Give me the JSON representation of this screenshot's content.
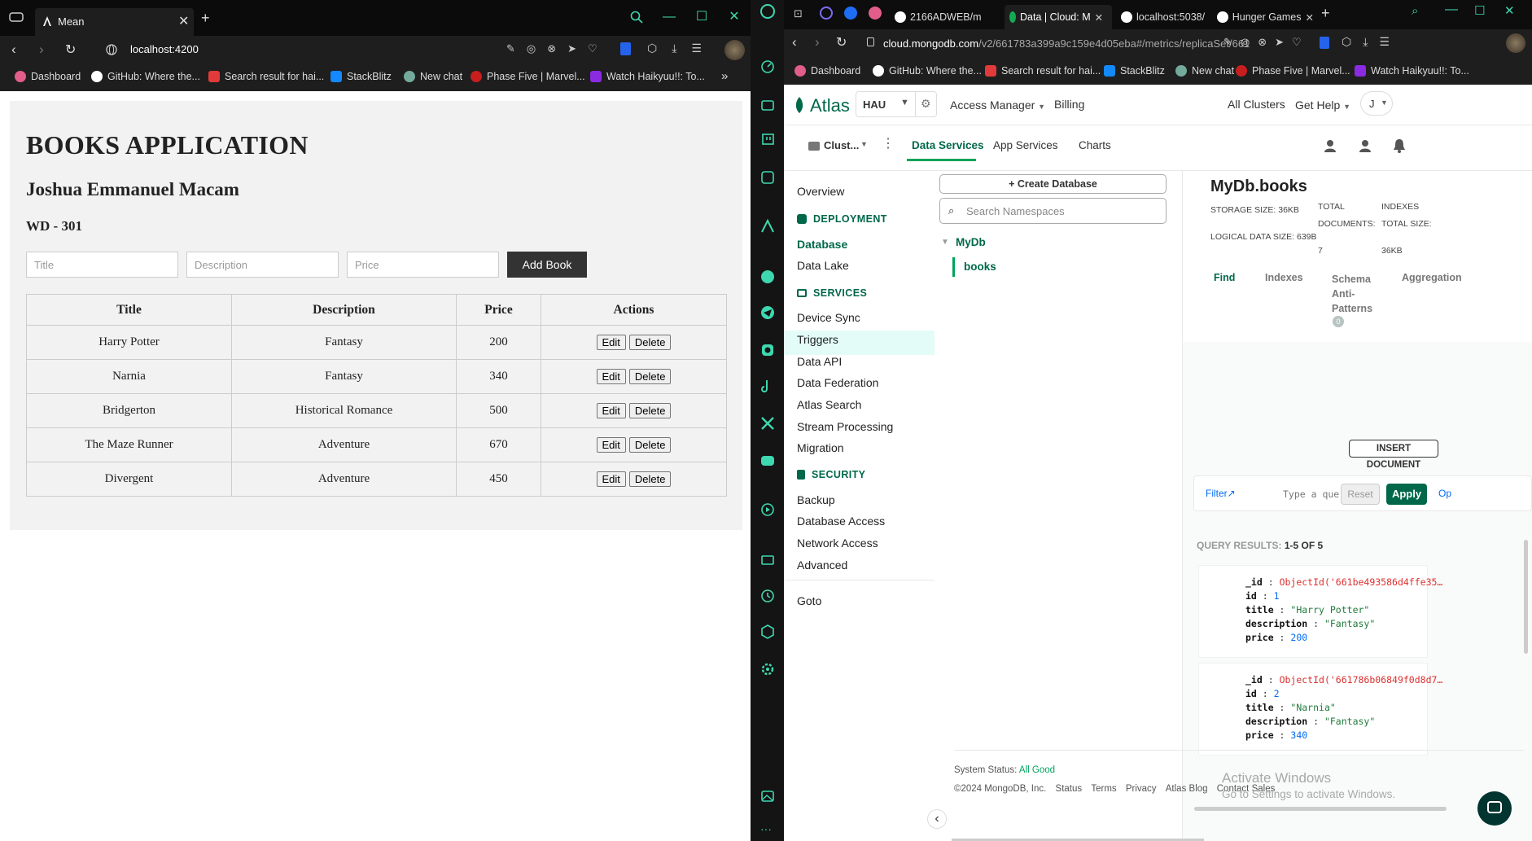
{
  "left_browser": {
    "tab_title": "Mean",
    "url": "localhost:4200",
    "bookmarks": [
      "Dashboard",
      "GitHub: Where the...",
      "Search result for hai...",
      "StackBlitz",
      "New chat",
      "Phase Five | Marvel...",
      "Watch Haikyuu!!: To..."
    ]
  },
  "books_app": {
    "title": "BOOKS APPLICATION",
    "author": "Joshua Emmanuel Macam",
    "section": "WD - 301",
    "inputs": {
      "title_placeholder": "Title",
      "description_placeholder": "Description",
      "price_placeholder": "Price"
    },
    "add_button": "Add Book",
    "columns": [
      "Title",
      "Description",
      "Price",
      "Actions"
    ],
    "rows": [
      {
        "title": "Harry Potter",
        "description": "Fantasy",
        "price": "200"
      },
      {
        "title": "Narnia",
        "description": "Fantasy",
        "price": "340"
      },
      {
        "title": "Bridgerton",
        "description": "Historical Romance",
        "price": "500"
      },
      {
        "title": "The Maze Runner",
        "description": "Adventure",
        "price": "670"
      },
      {
        "title": "Divergent",
        "description": "Adventure",
        "price": "450"
      }
    ],
    "edit_label": "Edit",
    "delete_label": "Delete"
  },
  "right_browser": {
    "tabs": [
      "2166ADWEB/m",
      "Data | Cloud: M",
      "localhost:5038/",
      "Hunger Games"
    ],
    "url_domain": "cloud.mongodb.com",
    "url_path": "/v2/661783a399a9c159e4d05eba#/metrics/replicaSet/661",
    "bookmarks": [
      "Dashboard",
      "GitHub: Where the...",
      "Search result for hai...",
      "StackBlitz",
      "New chat",
      "Phase Five | Marvel...",
      "Watch Haikyuu!!: To..."
    ]
  },
  "atlas": {
    "logo": "Atlas",
    "org": "HAU",
    "access_manager": "Access Manager",
    "billing": "Billing",
    "all_clusters": "All Clusters",
    "get_help": "Get Help",
    "user_initial": "J",
    "cluster_label": "Clust...",
    "top_tabs": [
      "Data Services",
      "App Services",
      "Charts"
    ],
    "nav": {
      "overview": "Overview",
      "deployment": "DEPLOYMENT",
      "deployment_items": [
        "Database",
        "Data Lake"
      ],
      "services": "SERVICES",
      "services_items": [
        "Device Sync",
        "Triggers",
        "Data API",
        "Data Federation",
        "Atlas Search",
        "Stream Processing",
        "Migration"
      ],
      "security": "SECURITY",
      "security_items": [
        "Backup",
        "Database Access",
        "Network Access",
        "Advanced"
      ],
      "goto": "Goto"
    },
    "create_db": "Create Database",
    "search_placeholder": "Search Namespaces",
    "db_name": "MyDb",
    "collection_name": "books",
    "collection_title": "MyDb.books",
    "storage_size": "STORAGE SIZE: 36KB",
    "logical_size": "LOGICAL DATA SIZE: 639B",
    "total_documents_label1": "TOTAL",
    "total_documents_label2": "DOCUMENTS:",
    "total_documents": "7",
    "indexes_label1": "INDEXES",
    "indexes_label2": "TOTAL SIZE:",
    "indexes_size": "36KB",
    "coll_tabs": [
      "Find",
      "Indexes",
      "Schema Anti-Patterns",
      "Aggregation"
    ],
    "schema_badge": "0",
    "insert_doc": "INSERT DOCUMENT",
    "filter": "Filter",
    "query_placeholder": "Type a que",
    "reset": "Reset",
    "apply": "Apply",
    "options_cut": "Op",
    "query_results_label": "QUERY RESULTS:",
    "query_results_range": "1-5 OF 5",
    "documents": [
      {
        "_id": "ObjectId('661be493586d4ffe35…",
        "id": "1",
        "title": "\"Harry Potter\"",
        "description": "\"Fantasy\"",
        "price": "200"
      },
      {
        "_id": "ObjectId('661786b06849f0d8d7…",
        "id": "2",
        "title": "\"Narnia\"",
        "description": "\"Fantasy\"",
        "price": "340"
      }
    ],
    "system_status_label": "System Status:",
    "system_status_value": "All Good",
    "footer": [
      "©2024 MongoDB, Inc.",
      "Status",
      "Terms",
      "Privacy",
      "Atlas Blog",
      "Contact Sales"
    ],
    "watermark1": "Activate Windows",
    "watermark2": "Go to Settings to activate Windows."
  },
  "colors": {
    "atlas_green": "#00684a",
    "atlas_btn": "#00684a",
    "link_blue": "#016bf8"
  }
}
